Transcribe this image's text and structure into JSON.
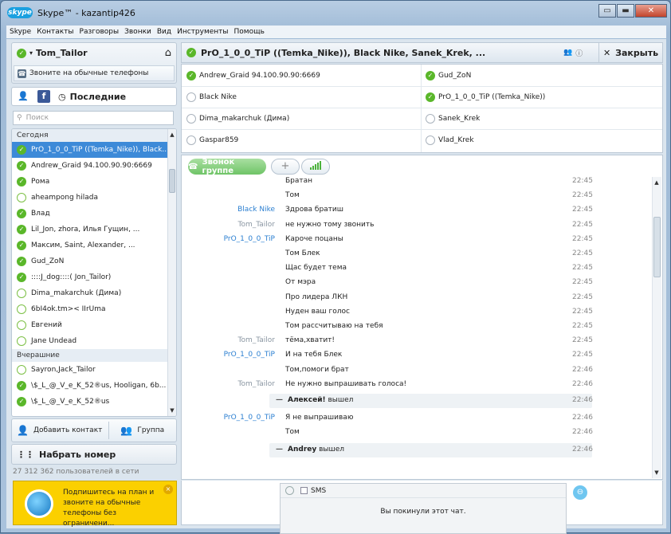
{
  "window": {
    "title": "Skype™ - kazantip426",
    "logo_text": "skype",
    "min": "▭",
    "max": "▬",
    "close": "✕"
  },
  "menu": [
    "Skype",
    "Контакты",
    "Разговоры",
    "Звонки",
    "Вид",
    "Инструменты",
    "Помощь"
  ],
  "user": {
    "name": "Tom_Tailor",
    "call_phones": "Звоните на обычные телефоны"
  },
  "tabs": {
    "recent": "Последние"
  },
  "search": {
    "placeholder": "Поиск"
  },
  "contacts": {
    "groups": [
      {
        "label": "Сегодня"
      },
      {
        "label": "Вчерашние"
      }
    ],
    "today": [
      {
        "name": "PrO_1_0_0_TiP ((Temka_Nike)), Black...",
        "status": "online"
      },
      {
        "name": "Andrew_Graid 94.100.90.90:6669",
        "status": "online"
      },
      {
        "name": "Рома",
        "status": "online"
      },
      {
        "name": "aheampong hilada",
        "status": "away"
      },
      {
        "name": "Влад",
        "status": "online"
      },
      {
        "name": "Lil_Jon, zhora, Илья Гущин, ...",
        "status": "online"
      },
      {
        "name": "Максим, Saint, Alexander, ...",
        "status": "online"
      },
      {
        "name": "Gud_ZoN",
        "status": "online"
      },
      {
        "name": "::::J_dog::::( Jon_Tailor)",
        "status": "online"
      },
      {
        "name": "Dima_makarchuk (Дима)",
        "status": "away"
      },
      {
        "name": "6bI4ok.tm>< IIrUma",
        "status": "away"
      },
      {
        "name": "Евгений",
        "status": "away"
      },
      {
        "name": "Jane Undead",
        "status": "away"
      }
    ],
    "yesterday": [
      {
        "name": "Sayron,Jack_Tailor",
        "status": "away"
      },
      {
        "name": "\\$_L_@_V_e_K_52®us, Hooligan, 6b...",
        "status": "online"
      },
      {
        "name": "\\$_L_@_V_e_K_52®us",
        "status": "online"
      }
    ]
  },
  "actions": {
    "add_contact": "Добавить контакт",
    "group": "Группа",
    "dial": "Набрать номер",
    "online_count": "27 312 362 пользователей в сети"
  },
  "promo": {
    "text": "Подпишитесь на план и звоните на обычные телефоны без ограничени...",
    "close": "×"
  },
  "chat": {
    "title": "PrO_1_0_0_TiP ((Temka_Nike)), Black Nike, Sanek_Krek, ...",
    "close": "Закрыть",
    "members": [
      {
        "name": "Andrew_Graid 94.100.90.90:6669",
        "status": "online"
      },
      {
        "name": "Gud_ZoN",
        "status": "online"
      },
      {
        "name": "Black Nike",
        "status": "offline"
      },
      {
        "name": "PrO_1_0_0_TiP ((Temka_Nike))",
        "status": "online"
      },
      {
        "name": "Dima_makarchuk (Дима)",
        "status": "offline"
      },
      {
        "name": "Sanek_Krek",
        "status": "offline"
      },
      {
        "name": "Gaspar859",
        "status": "offline"
      },
      {
        "name": "Vlad_Krek",
        "status": "offline"
      }
    ],
    "call_group": "Звонок группе",
    "plus": "+",
    "messages": [
      {
        "who": "",
        "text": "Братан",
        "time": "22:45"
      },
      {
        "who": "",
        "text": "Том",
        "time": "22:45"
      },
      {
        "who": "Black Nike",
        "text": "Здрова братиш",
        "time": "22:45",
        "color": "blue"
      },
      {
        "who": "Tom_Tailor",
        "text": "не нужно тому звонить",
        "time": "22:45",
        "color": "grey"
      },
      {
        "who": "PrO_1_0_0_TiP",
        "text": "Кароче поцаны",
        "time": "22:45",
        "color": "blue"
      },
      {
        "who": "",
        "text": "Том Блек",
        "time": "22:45"
      },
      {
        "who": "",
        "text": "Щас будет тема",
        "time": "22:45"
      },
      {
        "who": "",
        "text": "От мэра",
        "time": "22:45"
      },
      {
        "who": "",
        "text": "Про лидера ЛКН",
        "time": "22:45"
      },
      {
        "who": "",
        "text": "Нуден ваш голос",
        "time": "22:45"
      },
      {
        "who": "",
        "text": "Том рассчитываю на тебя",
        "time": "22:45"
      },
      {
        "who": "Tom_Tailor",
        "text": "тёма,хватит!",
        "time": "22:45",
        "color": "grey"
      },
      {
        "who": "PrO_1_0_0_TiP",
        "text": "И на тебя Блек",
        "time": "22:45",
        "color": "blue"
      },
      {
        "who": "",
        "text": "Том,помоги брат",
        "time": "22:46"
      },
      {
        "who": "Tom_Tailor",
        "text": "Не нужно выпрашивать голоса!",
        "time": "22:46",
        "color": "grey"
      }
    ],
    "system1": {
      "name": "Алексей!",
      "text": " вышел",
      "time": "22:46"
    },
    "messages2": [
      {
        "who": "PrO_1_0_0_TiP",
        "text": "Я не выпрашиваю",
        "time": "22:46",
        "color": "blue"
      },
      {
        "who": "",
        "text": "Том",
        "time": "22:46"
      }
    ],
    "system2": {
      "name": "Andrey",
      "text": " вышел",
      "time": "22:46"
    },
    "sms": "SMS",
    "left_chat": "Вы покинули этот чат."
  }
}
